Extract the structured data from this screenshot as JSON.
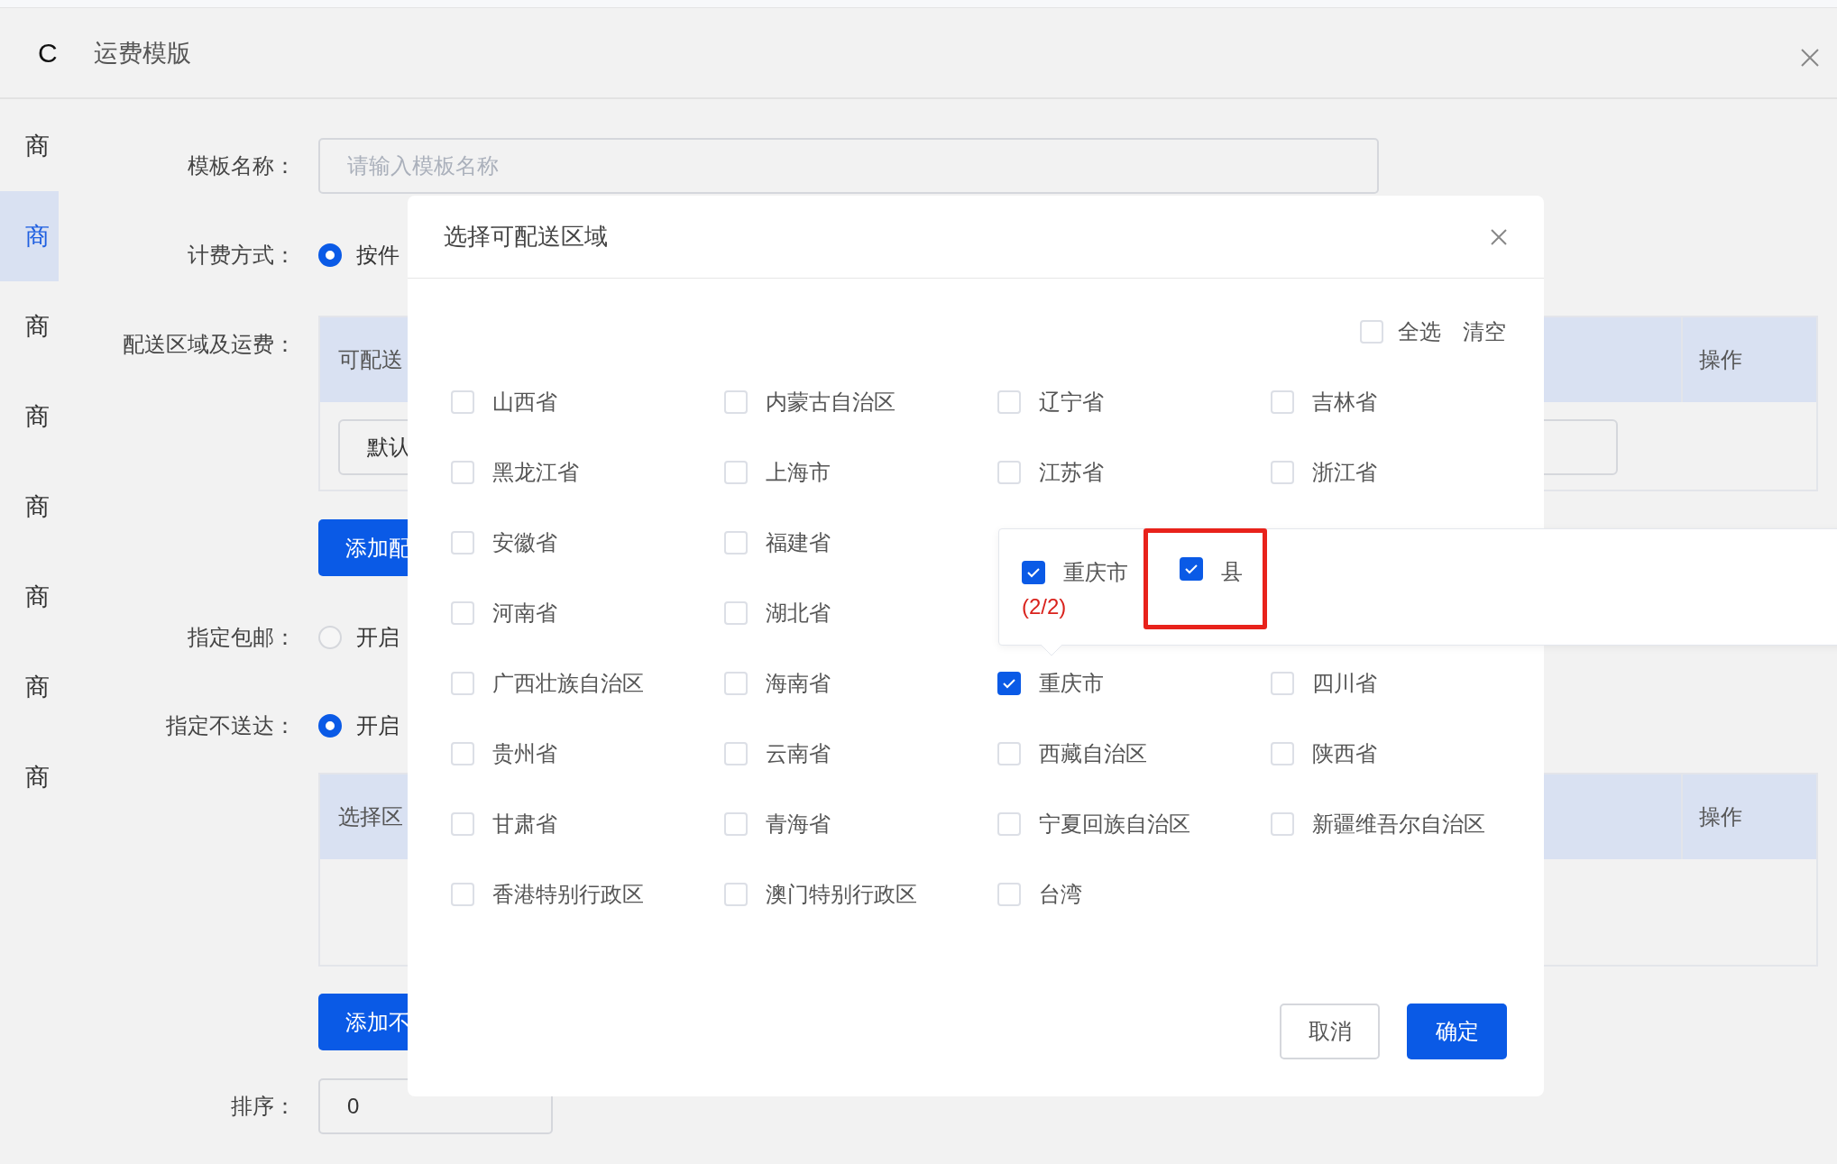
{
  "header": {
    "back_glyph": "C",
    "title": "运费模版"
  },
  "sidebar": {
    "items": [
      {
        "label": "商",
        "selected": false
      },
      {
        "label": "商",
        "selected": true
      },
      {
        "label": "商",
        "selected": false
      },
      {
        "label": "商",
        "selected": false
      },
      {
        "label": "商",
        "selected": false
      },
      {
        "label": "商",
        "selected": false
      },
      {
        "label": "商",
        "selected": false
      },
      {
        "label": "商",
        "selected": false
      }
    ]
  },
  "form": {
    "template_name": {
      "label": "模板名称：",
      "placeholder": "请输入模板名称"
    },
    "billing": {
      "label": "计费方式：",
      "options": [
        {
          "label": "按件",
          "selected": true
        }
      ]
    },
    "delivery": {
      "label": "配送区域及运费：",
      "columns": [
        "可配送",
        "操作"
      ],
      "row_value": "默认",
      "add_button": "添加配"
    },
    "free_shipping": {
      "label": "指定包邮：",
      "options": [
        {
          "label": "开启",
          "selected": false
        }
      ]
    },
    "no_delivery": {
      "label": "指定不送达：",
      "options": [
        {
          "label": "开启",
          "selected": true
        }
      ],
      "columns": [
        "选择区",
        "操作"
      ],
      "add_button": "添加不"
    },
    "sort": {
      "label": "排序：",
      "value": "0"
    }
  },
  "dialog": {
    "title": "选择可配送区域",
    "select_all": {
      "label": "全选",
      "checked": false
    },
    "clear": "清空",
    "rows": [
      [
        {
          "label": "山西省",
          "checked": false
        },
        {
          "label": "内蒙古自治区",
          "checked": false
        },
        {
          "label": "辽宁省",
          "checked": false
        },
        {
          "label": "吉林省",
          "checked": false
        }
      ],
      [
        {
          "label": "黑龙江省",
          "checked": false
        },
        {
          "label": "上海市",
          "checked": false
        },
        {
          "label": "江苏省",
          "checked": false
        },
        {
          "label": "浙江省",
          "checked": false
        }
      ],
      [
        {
          "label": "安徽省",
          "checked": false
        },
        {
          "label": "福建省",
          "checked": false
        }
      ],
      [
        {
          "label": "河南省",
          "checked": false
        },
        {
          "label": "湖北省",
          "checked": false
        }
      ],
      [
        {
          "label": "广西壮族自治区",
          "checked": false
        },
        {
          "label": "海南省",
          "checked": false
        },
        {
          "label": "重庆市",
          "checked": true
        },
        {
          "label": "四川省",
          "checked": false
        }
      ],
      [
        {
          "label": "贵州省",
          "checked": false
        },
        {
          "label": "云南省",
          "checked": false
        },
        {
          "label": "西藏自治区",
          "checked": false
        },
        {
          "label": "陕西省",
          "checked": false
        }
      ],
      [
        {
          "label": "甘肃省",
          "checked": false
        },
        {
          "label": "青海省",
          "checked": false
        },
        {
          "label": "宁夏回族自治区",
          "checked": false
        },
        {
          "label": "新疆维吾尔自治区",
          "checked": false
        }
      ],
      [
        {
          "label": "香港特别行政区",
          "checked": false
        },
        {
          "label": "澳门特别行政区",
          "checked": false
        },
        {
          "label": "台湾",
          "checked": false
        }
      ]
    ],
    "popover": {
      "city": {
        "label": "重庆市",
        "checked": true,
        "count": "(2/2)"
      },
      "districts": [
        {
          "label": "县",
          "checked": true,
          "highlighted": true
        }
      ]
    },
    "buttons": {
      "cancel": "取消",
      "confirm": "确定"
    }
  }
}
